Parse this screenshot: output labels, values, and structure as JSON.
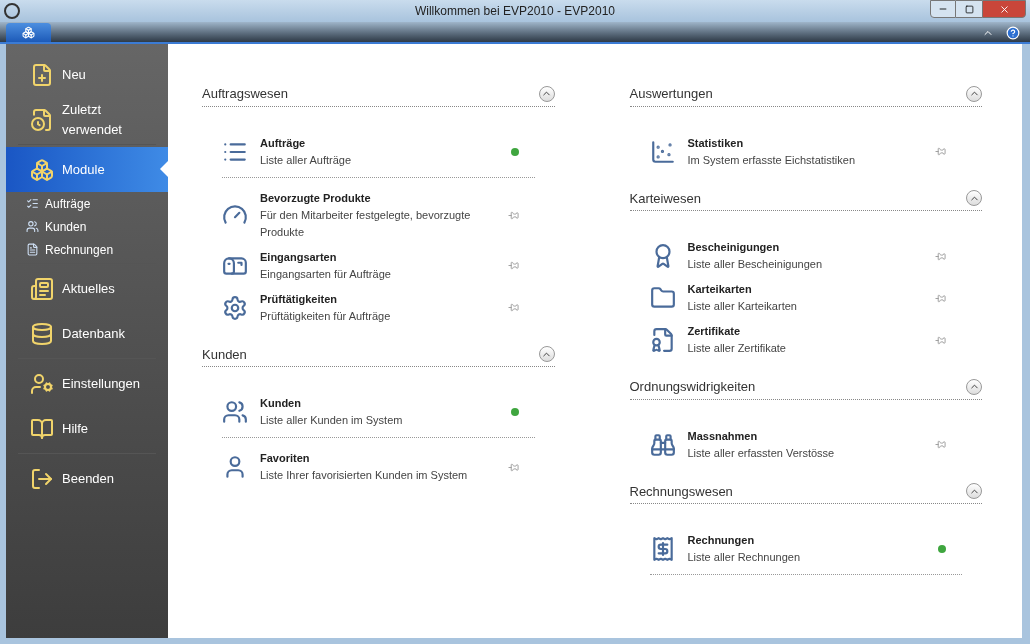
{
  "window": {
    "title": "Willkommen bei EVP2010 - EVP2010"
  },
  "sidebar": {
    "items": [
      {
        "label": "Neu",
        "kind": "large",
        "selected": false
      },
      {
        "label": "Zuletzt verwendet",
        "kind": "large",
        "selected": false
      },
      {
        "label": "Module",
        "kind": "large",
        "selected": true
      },
      {
        "label": "Aufträge",
        "kind": "small",
        "selected": false
      },
      {
        "label": "Kunden",
        "kind": "small",
        "selected": false
      },
      {
        "label": "Rechnungen",
        "kind": "small",
        "selected": false
      },
      {
        "label": "Aktuelles",
        "kind": "large",
        "selected": false
      },
      {
        "label": "Datenbank",
        "kind": "large",
        "selected": false
      },
      {
        "label": "Einstellungen",
        "kind": "large",
        "selected": false
      },
      {
        "label": "Hilfe",
        "kind": "large",
        "selected": false
      },
      {
        "label": "Beenden",
        "kind": "large",
        "selected": false
      }
    ]
  },
  "columns": [
    [
      {
        "title": "Auftragswesen",
        "items": [
          {
            "name": "Aufträge",
            "description": "Liste aller Aufträge",
            "pinned": true
          },
          {
            "name": "Bevorzugte Produkte",
            "description": "Für den Mitarbeiter festgelegte, bevorzugte Produkte",
            "pinned": false
          },
          {
            "name": "Eingangsarten",
            "description": "Eingangsarten für Aufträge",
            "pinned": false
          },
          {
            "name": "Prüftätigkeiten",
            "description": "Prüftätigkeiten für Aufträge",
            "pinned": false
          }
        ]
      },
      {
        "title": "Kunden",
        "items": [
          {
            "name": "Kunden",
            "description": "Liste aller Kunden im System",
            "pinned": true
          },
          {
            "name": "Favoriten",
            "description": "Liste Ihrer favorisierten Kunden im System",
            "pinned": false
          }
        ]
      }
    ],
    [
      {
        "title": "Auswertungen",
        "items": [
          {
            "name": "Statistiken",
            "description": "Im System erfasste Eichstatistiken",
            "pinned": false
          }
        ]
      },
      {
        "title": "Karteiwesen",
        "items": [
          {
            "name": "Bescheinigungen",
            "description": "Liste aller Bescheinigungen",
            "pinned": false
          },
          {
            "name": "Karteikarten",
            "description": "Liste aller Karteikarten",
            "pinned": false
          },
          {
            "name": "Zertifikate",
            "description": "Liste aller Zertifikate",
            "pinned": false
          }
        ]
      },
      {
        "title": "Ordnungswidrigkeiten",
        "items": [
          {
            "name": "Massnahmen",
            "description": "Liste aller erfassten Verstösse",
            "pinned": false
          }
        ]
      },
      {
        "title": "Rechnungswesen",
        "items": [
          {
            "name": "Rechnungen",
            "description": "Liste aller Rechnungen",
            "pinned": true
          }
        ]
      }
    ]
  ]
}
